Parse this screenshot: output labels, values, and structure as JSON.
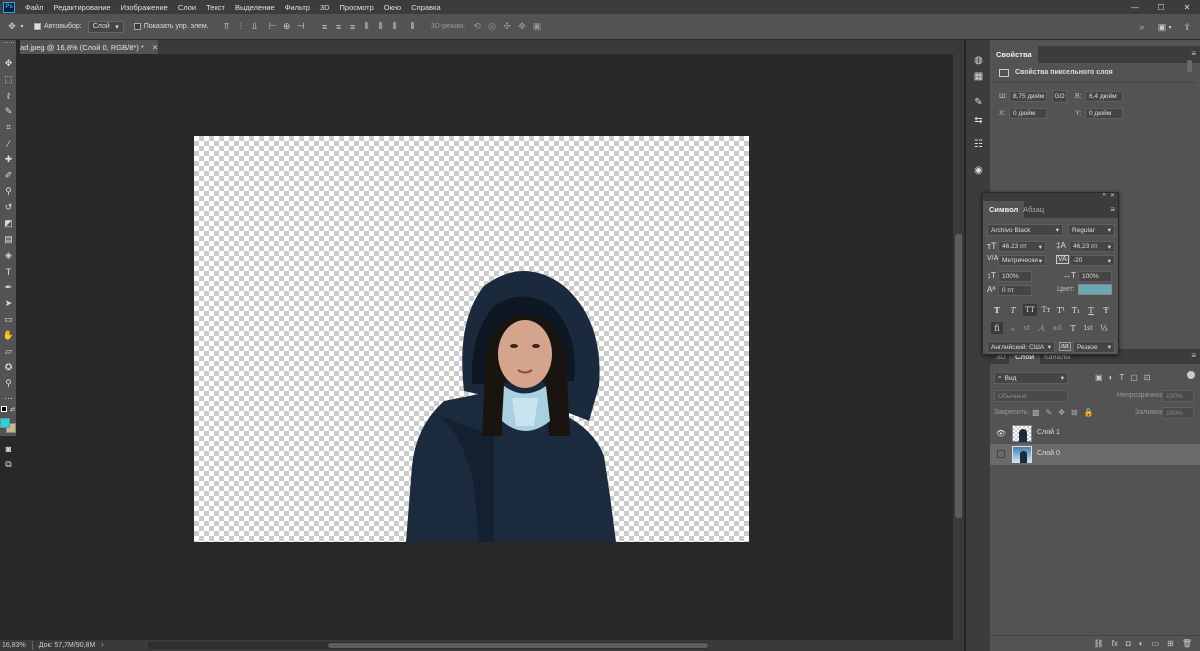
{
  "menu": {
    "logo": "Ps",
    "items": [
      "Файл",
      "Редактирование",
      "Изображение",
      "Слои",
      "Текст",
      "Выделение",
      "Фильтр",
      "3D",
      "Просмотр",
      "Окно",
      "Справка"
    ],
    "window_controls": [
      "—",
      "☐",
      "✕"
    ]
  },
  "options_bar": {
    "autoselect_label": "Автовыбор:",
    "autoselect_value": "Слой",
    "show_transform_label": "Показать упр. элем.",
    "mode_3d_label": "3D-режим:"
  },
  "document_tab": {
    "title": "ad.jpeg @ 16,8% (Слой 0, RGB/8*) *",
    "close": "✕"
  },
  "status_bar": {
    "zoom": "16,83%",
    "doc_info": "Док: 57,7M/90,8M",
    "arrow": "›"
  },
  "properties": {
    "tab": "Свойства",
    "section": "Свойства пиксельного слоя",
    "w_label": "Ш:",
    "w_value": "8,75 дюйм",
    "link_label": "GO",
    "h_label": "В:",
    "h_value": "6,4 дюйм",
    "x_label": "X:",
    "x_value": "0 дюйм",
    "y_label": "Y:",
    "y_value": "0 дюйм"
  },
  "character": {
    "tabs": [
      "Символ",
      "Абзац"
    ],
    "font_family": "Archivo Black",
    "font_style": "Regular",
    "font_size": "46,23 пт",
    "leading": "46,23 пт",
    "kerning": "Метрически",
    "tracking": "-20",
    "vscale": "100%",
    "hscale": "100%",
    "baseline": "0 пт",
    "color_label": "Цвет:",
    "color_value": "#6aa8b4",
    "language": "Английский: США",
    "aa_label": "aа",
    "antialias": "Резкое",
    "format_buttons_row1": [
      "T",
      "T",
      "TT",
      "Tт",
      "T¹",
      "T₁",
      "T",
      "Ŧ"
    ],
    "format_buttons_row2": [
      "fi",
      "ℴ",
      "st",
      "A",
      "ad",
      "T",
      "1st",
      "½"
    ]
  },
  "layers": {
    "tabs": [
      "3D",
      "Слои",
      "Каналы"
    ],
    "filter_label": "Вид",
    "blend_mode": "Обычные",
    "opacity_label": "Непрозрачность:",
    "opacity_value": "100%",
    "lock_label": "Закрепить:",
    "fill_label": "Заливка:",
    "fill_value": "100%",
    "items": [
      {
        "name": "Слой 1",
        "visible": true,
        "selected": false
      },
      {
        "name": "Слой 0",
        "visible": false,
        "selected": true
      }
    ],
    "footer_icons": [
      "link-icon",
      "fx-icon",
      "mask-icon",
      "adjustment-icon",
      "folder-icon",
      "new-layer-icon",
      "trash-icon"
    ],
    "footer_glyphs": [
      "⛓",
      "fx",
      "◘",
      "◐",
      "▭",
      "⊞",
      "🗑"
    ]
  },
  "colors": {
    "foreground": "#18d8e0",
    "background": "#c9b98d",
    "accent": "#2ba3f0"
  }
}
